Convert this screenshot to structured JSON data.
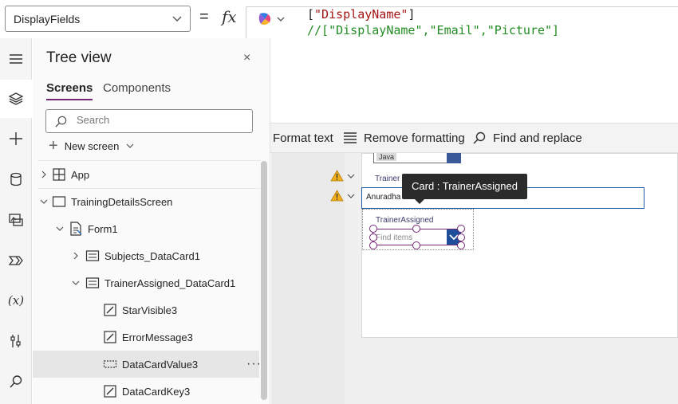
{
  "formula_bar": {
    "property": "DisplayFields",
    "eq": "=",
    "fx": "fx",
    "line1": {
      "open": "[",
      "value": "\"DisplayName\"",
      "close": "]"
    },
    "line2": "//[\"DisplayName\",\"Email\",\"Picture\"]"
  },
  "toolbar": {
    "format_text": "Format text",
    "remove_formatting": "Remove formatting",
    "find_replace": "Find and replace"
  },
  "rail": {
    "items": [
      "hamburger-icon",
      "layers-icon",
      "plus-icon",
      "database-icon",
      "media-icon",
      "components-icon",
      "variables-icon",
      "tools-icon",
      "search-icon"
    ],
    "variables_glyph": "(x)"
  },
  "tree": {
    "title": "Tree view",
    "close": "×",
    "tabs": [
      "Screens",
      "Components"
    ],
    "search_placeholder": "Search",
    "new_screen": "New screen",
    "nodes": [
      {
        "label": "App",
        "icon": "app-icon"
      },
      {
        "label": "TrainingDetailsScreen",
        "icon": "screen-icon"
      },
      {
        "label": "Form1",
        "icon": "form-icon"
      },
      {
        "label": "Subjects_DataCard1",
        "icon": "card-icon"
      },
      {
        "label": "TrainerAssigned_DataCard1",
        "icon": "card-icon"
      },
      {
        "label": "StarVisible3",
        "icon": "edit-icon"
      },
      {
        "label": "ErrorMessage3",
        "icon": "edit-icon"
      },
      {
        "label": "DataCardValue3",
        "icon": "combobox-icon",
        "selected": true,
        "more": "···"
      },
      {
        "label": "DataCardKey3",
        "icon": "edit-icon"
      }
    ]
  },
  "canvas": {
    "java_tag": "Java",
    "trainer_label_1": "Trainer",
    "text_value": "Anuradha",
    "trainer_label_2": "TrainerAssigned",
    "combo_placeholder": "Find items",
    "tooltip": "Card : TrainerAssigned"
  },
  "colors": {
    "accent": "#742774",
    "combo_dropdown": "#1e4e9a",
    "warning": "#f2b01e",
    "string": "#a31515",
    "comment": "#228b22"
  }
}
